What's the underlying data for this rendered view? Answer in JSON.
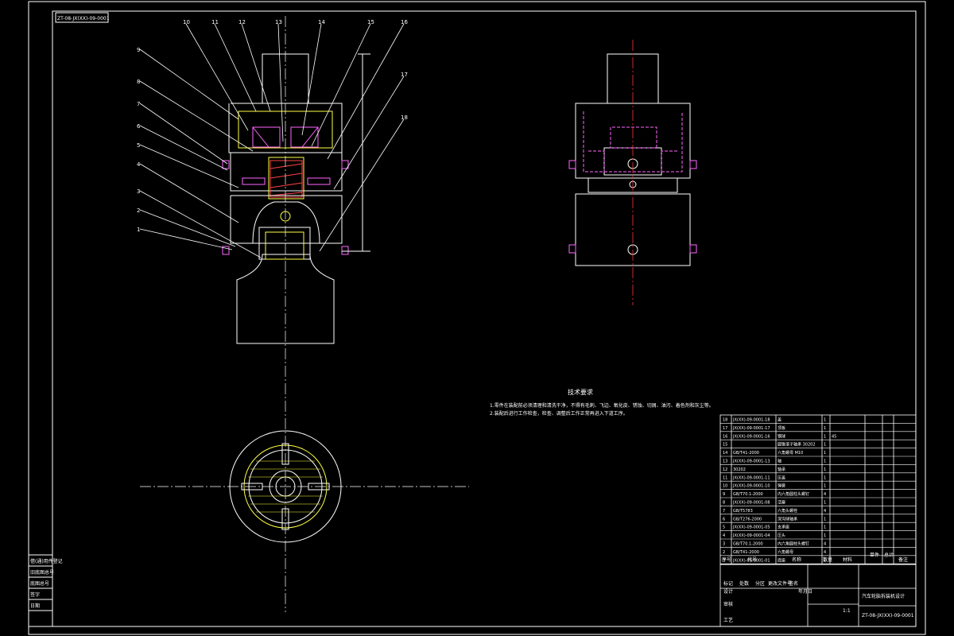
{
  "drawing": {
    "code_box": "ZT-08-JX(XX)-09-0001",
    "part_labels": [
      "1",
      "2",
      "3",
      "4",
      "5",
      "6",
      "7",
      "8",
      "9",
      "10",
      "11",
      "12",
      "13",
      "14",
      "15",
      "16",
      "17",
      "18"
    ],
    "notes_title": "技术要求",
    "notes": [
      "1.零件在装配前必须清理和清洗干净，不得有毛刺、飞边、氧化皮、锈蚀、切屑、油污、着色剂和灰尘等。",
      "2.装配后进行工作检查，检查、调整后工作正常再进入下道工序。"
    ]
  },
  "title_block": {
    "bom_headers": [
      "序号",
      "代号",
      "名称",
      "数量",
      "材料",
      "单件",
      "总计",
      "备注"
    ],
    "bom_rows": [
      {
        "n": "18",
        "code": "JX(XX)-09-0001-18",
        "name": "盖",
        "qty": "1",
        "mat": ""
      },
      {
        "n": "17",
        "code": "JX(XX)-09-0001-17",
        "name": "顶板",
        "qty": "1",
        "mat": ""
      },
      {
        "n": "16",
        "code": "JX(XX)-09-0001-16",
        "name": "钢球",
        "qty": "1",
        "mat": "45"
      },
      {
        "n": "15",
        "code": "",
        "name": "圆锥滚子轴承 30202",
        "qty": "1",
        "mat": ""
      },
      {
        "n": "14",
        "code": "GB/T41-2000",
        "name": "六角螺母 M10",
        "qty": "1",
        "mat": ""
      },
      {
        "n": "13",
        "code": "JX(XX)-09-0001-13",
        "name": "轴",
        "qty": "1",
        "mat": ""
      },
      {
        "n": "12",
        "code": "30202",
        "name": "轴承",
        "qty": "1",
        "mat": ""
      },
      {
        "n": "11",
        "code": "JX(XX)-09-0001-11",
        "name": "压盖",
        "qty": "1",
        "mat": ""
      },
      {
        "n": "10",
        "code": "JX(XX)-09-0001-10",
        "name": "弹簧",
        "qty": "1",
        "mat": ""
      },
      {
        "n": "9",
        "code": "GB/T70.1-2000",
        "name": "内六角圆柱头螺钉",
        "qty": "4",
        "mat": ""
      },
      {
        "n": "8",
        "code": "JX(XX)-09-0001-08",
        "name": "活塞",
        "qty": "1",
        "mat": ""
      },
      {
        "n": "7",
        "code": "GB/T5783",
        "name": "六角头螺栓",
        "qty": "4",
        "mat": ""
      },
      {
        "n": "6",
        "code": "GB/T276-2000",
        "name": "深沟球轴承",
        "qty": "1",
        "mat": ""
      },
      {
        "n": "5",
        "code": "JX(XX)-09-0001-05",
        "name": "支承座",
        "qty": "1",
        "mat": ""
      },
      {
        "n": "4",
        "code": "JX(XX)-09-0001-04",
        "name": "压头",
        "qty": "1",
        "mat": ""
      },
      {
        "n": "3",
        "code": "GB/T70.1-2000",
        "name": "内六角圆柱头螺钉",
        "qty": "4",
        "mat": ""
      },
      {
        "n": "2",
        "code": "GB/T41-2000",
        "name": "六角螺母",
        "qty": "4",
        "mat": ""
      },
      {
        "n": "1",
        "code": "JX(XX)-09-0001-01",
        "name": "底座",
        "qty": "1",
        "mat": ""
      }
    ],
    "drawing_number": "ZT-08-JX(XX)-09-0001",
    "title": "汽车轮胎拆装机设计",
    "scale_label": "1:1",
    "sign_labels": [
      "设计",
      "审核",
      "工艺",
      "标记",
      "处数",
      "分区",
      "更改文件号",
      "签名",
      "年月日"
    ],
    "left_strip": [
      "借(通)用件登记",
      "旧底图总号",
      "底图总号",
      "签字",
      "日期"
    ]
  }
}
